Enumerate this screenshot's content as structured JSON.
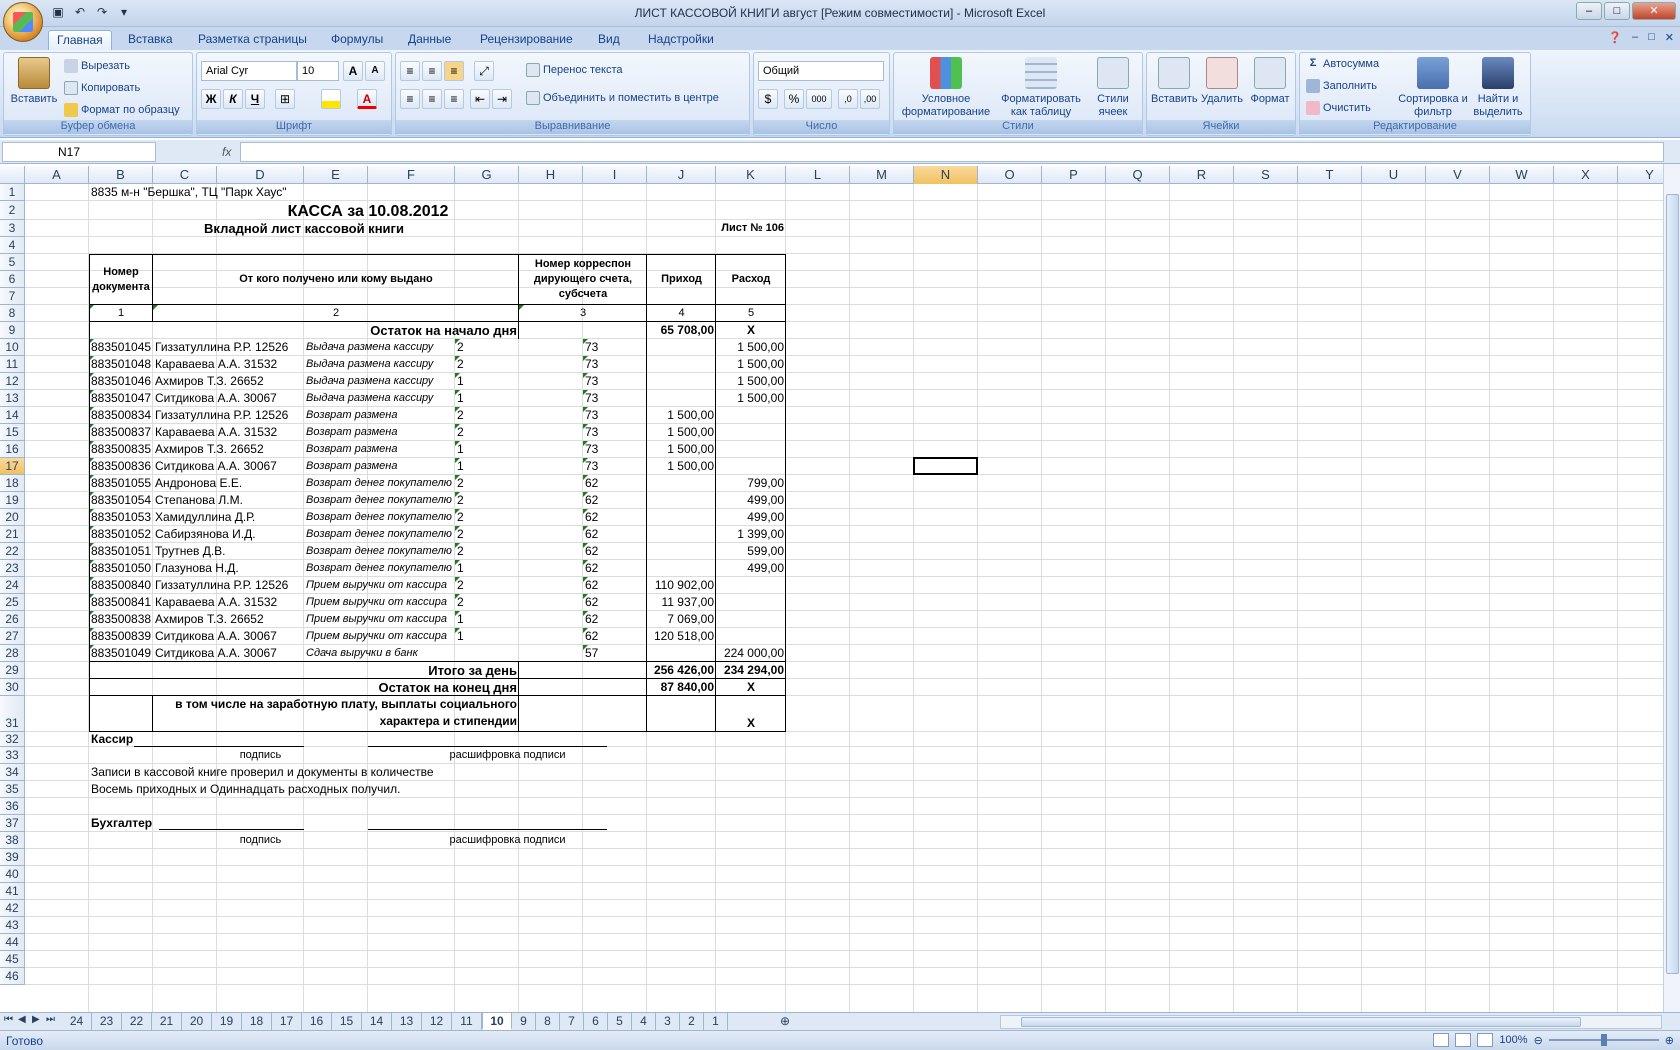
{
  "window": {
    "title": "ЛИСТ КАССОВОЙ КНИГИ август  [Режим совместимости] - Microsoft Excel",
    "min": "–",
    "max": "□",
    "close": "✕"
  },
  "tabs": [
    "Главная",
    "Вставка",
    "Разметка страницы",
    "Формулы",
    "Данные",
    "Рецензирование",
    "Вид",
    "Надстройки"
  ],
  "ribbon": {
    "clipboard": {
      "label": "Буфер обмена",
      "paste": "Вставить",
      "cut": "Вырезать",
      "copy": "Копировать",
      "format_painter": "Формат по образцу"
    },
    "font": {
      "label": "Шрифт",
      "font_name": "Arial Cyr",
      "font_size": "10",
      "bold": "Ж",
      "italic": "К",
      "underline": "Ч"
    },
    "alignment": {
      "label": "Выравнивание",
      "wrap": "Перенос текста",
      "merge": "Объединить и поместить в центре"
    },
    "number": {
      "label": "Число",
      "format": "Общий",
      "percent": "%",
      "thousands": "000"
    },
    "styles": {
      "label": "Стили",
      "conditional": "Условное форматирование",
      "as_table": "Форматировать как таблицу",
      "cell_styles": "Стили ячеек"
    },
    "cells": {
      "label": "Ячейки",
      "insert": "Вставить",
      "delete": "Удалить",
      "format": "Формат"
    },
    "editing": {
      "label": "Редактирование",
      "autosum": "Автосумма",
      "fill": "Заполнить",
      "clear": "Очистить",
      "sort": "Сортировка и фильтр",
      "find": "Найти и выделить"
    }
  },
  "formula_bar": {
    "name_box": "N17",
    "fx": "fx",
    "value": ""
  },
  "columns": [
    "A",
    "B",
    "C",
    "D",
    "E",
    "F",
    "G",
    "H",
    "I",
    "J",
    "K",
    "L",
    "M",
    "N",
    "O",
    "P",
    "Q",
    "R",
    "S",
    "T",
    "U",
    "V",
    "W",
    "X",
    "Y"
  ],
  "rows": [
    "1",
    "2",
    "3",
    "4",
    "5",
    "6",
    "7",
    "8",
    "9",
    "10",
    "11",
    "12",
    "13",
    "14",
    "15",
    "16",
    "17",
    "18",
    "19",
    "20",
    "21",
    "22",
    "23",
    "24",
    "25",
    "26",
    "27",
    "28",
    "29",
    "30",
    "31",
    "32",
    "33",
    "34",
    "35",
    "36",
    "37",
    "38",
    "39",
    "40",
    "41",
    "42",
    "43",
    "44",
    "45",
    "46"
  ],
  "sheet": {
    "store": "8835 м-н \"Бершка\", ТЦ \"Парк Хаус\"",
    "title": "КАССА за 10.08.2012",
    "subtitle": "Вкладной лист кассовой книги",
    "sheet_no": "Лист № 106",
    "hdr_doc": "Номер документа",
    "hdr_from": "От кого получено или кому выдано",
    "hdr_corr": "Номер корреспон дирующего счета, субсчета",
    "hdr_in": "Приход",
    "hdr_out": "Расход",
    "num1": "1",
    "num2": "2",
    "num3": "3",
    "num4": "4",
    "num5": "5",
    "open_label": "Остаток на начало дня",
    "open_in": "65 708,00",
    "open_out": "X",
    "entries": [
      {
        "doc": "883501045",
        "name": "Гиззатуллина Р.Р. 12526",
        "desc": "Выдача размена кассиру",
        "g": "2",
        "acc": "73",
        "in": "",
        "out": "1 500,00"
      },
      {
        "doc": "883501048",
        "name": "Караваева А.А.  31532",
        "desc": "Выдача размена кассиру",
        "g": "2",
        "acc": "73",
        "in": "",
        "out": "1 500,00"
      },
      {
        "doc": "883501046",
        "name": "Ахмиров Т.З. 26652",
        "desc": "Выдача размена кассиру",
        "g": "1",
        "acc": "73",
        "in": "",
        "out": "1 500,00"
      },
      {
        "doc": "883501047",
        "name": "Ситдикова А.А. 30067",
        "desc": "Выдача размена кассиру",
        "g": "1",
        "acc": "73",
        "in": "",
        "out": "1 500,00"
      },
      {
        "doc": "883500834",
        "name": "Гиззатуллина Р.Р. 12526",
        "desc": "Возврат размена",
        "g": "2",
        "acc": "73",
        "in": "1 500,00",
        "out": ""
      },
      {
        "doc": "883500837",
        "name": "Караваева А.А.  31532",
        "desc": "Возврат размена",
        "g": "2",
        "acc": "73",
        "in": "1 500,00",
        "out": ""
      },
      {
        "doc": "883500835",
        "name": "Ахмиров Т.З. 26652",
        "desc": "Возврат размена",
        "g": "1",
        "acc": "73",
        "in": "1 500,00",
        "out": ""
      },
      {
        "doc": "883500836",
        "name": "Ситдикова А.А. 30067",
        "desc": "Возврат размена",
        "g": "1",
        "acc": "73",
        "in": "1 500,00",
        "out": ""
      },
      {
        "doc": "883501055",
        "name": "Андронова Е.Е.",
        "desc": "Возврат денег покупателю",
        "g": "2",
        "acc": "62",
        "in": "",
        "out": "799,00"
      },
      {
        "doc": "883501054",
        "name": "Степанова Л.М.",
        "desc": "Возврат денег покупателю",
        "g": "2",
        "acc": "62",
        "in": "",
        "out": "499,00"
      },
      {
        "doc": "883501053",
        "name": "Хамидуллина Д.Р.",
        "desc": "Возврат денег покупателю",
        "g": "2",
        "acc": "62",
        "in": "",
        "out": "499,00"
      },
      {
        "doc": "883501052",
        "name": "Сабирзянова И.Д.",
        "desc": "Возврат денег покупателю",
        "g": "2",
        "acc": "62",
        "in": "",
        "out": "1 399,00"
      },
      {
        "doc": "883501051",
        "name": "Трутнев Д.В.",
        "desc": "Возврат денег покупателю",
        "g": "2",
        "acc": "62",
        "in": "",
        "out": "599,00"
      },
      {
        "doc": "883501050",
        "name": "Глазунова Н.Д.",
        "desc": "Возврат денег покупателю",
        "g": "1",
        "acc": "62",
        "in": "",
        "out": "499,00"
      },
      {
        "doc": "883500840",
        "name": "Гиззатуллина Р.Р. 12526",
        "desc": "Прием выручки от кассира",
        "g": "2",
        "acc": "62",
        "in": "110 902,00",
        "out": ""
      },
      {
        "doc": "883500841",
        "name": "Караваева А.А.  31532",
        "desc": "Прием выручки от кассира",
        "g": "2",
        "acc": "62",
        "in": "11 937,00",
        "out": ""
      },
      {
        "doc": "883500838",
        "name": "Ахмиров Т.З. 26652",
        "desc": "Прием выручки от кассира",
        "g": "1",
        "acc": "62",
        "in": "7 069,00",
        "out": ""
      },
      {
        "doc": "883500839",
        "name": "Ситдикова А.А. 30067",
        "desc": "Прием выручки от кассира",
        "g": "1",
        "acc": "62",
        "in": "120 518,00",
        "out": ""
      },
      {
        "doc": "883501049",
        "name": "Ситдикова А.А. 30067",
        "desc": "Сдача выручки в банк",
        "g": "",
        "acc": "57",
        "in": "",
        "out": "224 000,00"
      }
    ],
    "total_label": "Итого за день",
    "total_in": "256 426,00",
    "total_out": "234 294,00",
    "close_label": "Остаток на конец дня",
    "close_in": "87 840,00",
    "close_out": "X",
    "incl_label1": "в том числе на заработную плату, выплаты социального",
    "incl_label2": "характера и стипендии",
    "incl_out": "X",
    "cashier": "Кассир",
    "sign": "подпись",
    "decode": "расшифровка подписи",
    "checked": "Записи в кассовой книге проверил и документы в количестве",
    "count": "Восемь приходных и Одиннадцать расходных получил.",
    "accountant": "Бухгалтер"
  },
  "sheet_tabs": [
    "24",
    "23",
    "22",
    "21",
    "20",
    "19",
    "18",
    "17",
    "16",
    "15",
    "14",
    "13",
    "12",
    "11",
    "10",
    "9",
    "8",
    "7",
    "6",
    "5",
    "4",
    "3",
    "2",
    "1"
  ],
  "active_tab": "10",
  "status": {
    "ready": "Готово",
    "zoom": "100%"
  }
}
